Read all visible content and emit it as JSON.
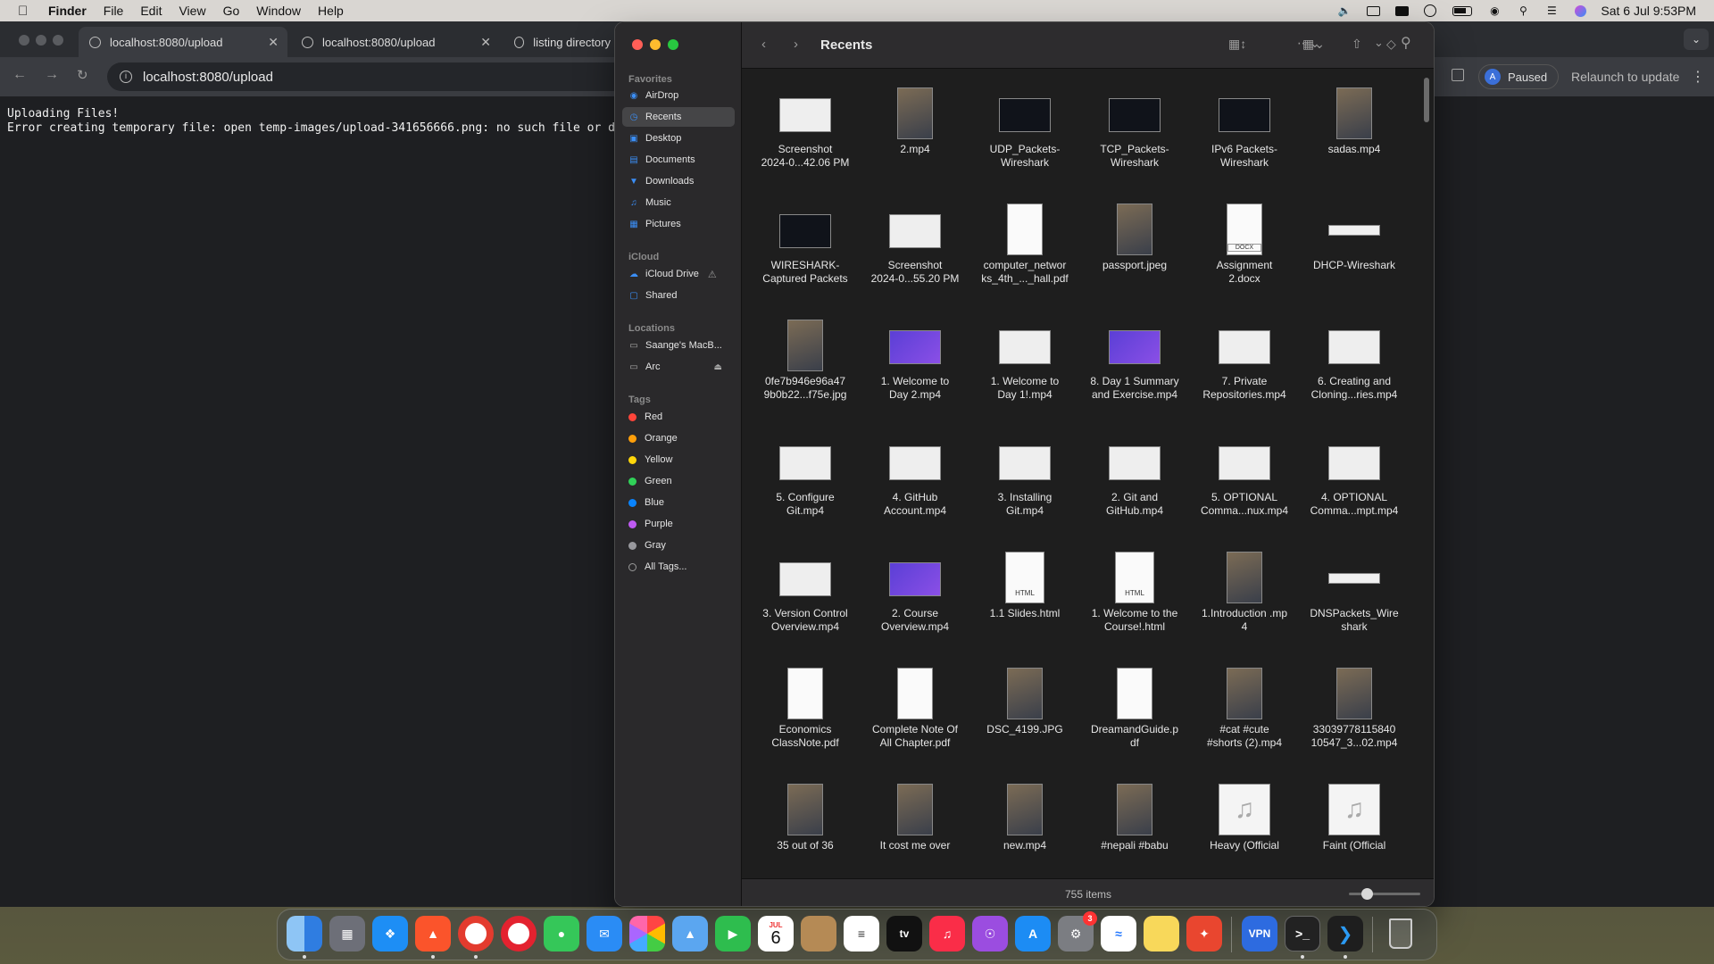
{
  "menubar": {
    "app": "Finder",
    "items": [
      "File",
      "Edit",
      "View",
      "Go",
      "Window",
      "Help"
    ],
    "clock": "Sat 6 Jul  9:53PM"
  },
  "browser": {
    "tabs": [
      {
        "title": "localhost:8080/upload"
      },
      {
        "title": "localhost:8080/upload"
      },
      {
        "title": "listing directory"
      }
    ],
    "url": "localhost:8080/upload",
    "profile_initial": "A",
    "profile_status": "Paused",
    "relaunch": "Relaunch to update",
    "content_line1": "Uploading Files!",
    "content_line2": "Error creating temporary file: open temp-images/upload-341656666.png: no such file or d"
  },
  "finder": {
    "title": "Recents",
    "sidebar": {
      "favorites_head": "Favorites",
      "favorites": [
        "AirDrop",
        "Recents",
        "Desktop",
        "Documents",
        "Downloads",
        "Music",
        "Pictures"
      ],
      "icloud_head": "iCloud",
      "icloud": [
        "iCloud Drive",
        "Shared"
      ],
      "locations_head": "Locations",
      "locations": [
        "Saange's MacB...",
        "Arc"
      ],
      "tags_head": "Tags",
      "tags": [
        {
          "name": "Red",
          "color": "#ff453a"
        },
        {
          "name": "Orange",
          "color": "#ff9f0a"
        },
        {
          "name": "Yellow",
          "color": "#ffd60a"
        },
        {
          "name": "Green",
          "color": "#30d158"
        },
        {
          "name": "Blue",
          "color": "#0a84ff"
        },
        {
          "name": "Purple",
          "color": "#bf5af2"
        },
        {
          "name": "Gray",
          "color": "#98989d"
        },
        {
          "name": "All Tags...",
          "color": ""
        }
      ]
    },
    "files": [
      [
        "Screenshot\n2024-0...42.06 PM",
        "2.mp4",
        "UDP_Packets-\nWireshark",
        "TCP_Packets-\nWireshark",
        "IPv6 Packets-\nWireshark",
        "sadas.mp4"
      ],
      [
        "WIRESHARK-\nCaptured Packets",
        "Screenshot\n2024-0...55.20 PM",
        "computer_networ\nks_4th_..._hall.pdf",
        "passport.jpeg",
        "Assignment\n2.docx",
        "DHCP-Wireshark"
      ],
      [
        "0fe7b946e96a47\n9b0b22...f75e.jpg",
        "1. Welcome to\nDay 2.mp4",
        "1. Welcome to\nDay 1!.mp4",
        "8. Day 1 Summary\nand Exercise.mp4",
        "7. Private\nRepositories.mp4",
        "6. Creating and\nCloning...ries.mp4"
      ],
      [
        "5. Configure\nGit.mp4",
        "4. GitHub\nAccount.mp4",
        "3. Installing\nGit.mp4",
        "2. Git and\nGitHub.mp4",
        "5. OPTIONAL\nComma...nux.mp4",
        "4. OPTIONAL\nComma...mpt.mp4"
      ],
      [
        "3. Version Control\nOverview.mp4",
        "2. Course\nOverview.mp4",
        "1.1 Slides.html",
        "1. Welcome to the\nCourse!.html",
        "1.Introduction .mp\n4",
        "DNSPackets_Wire\nshark"
      ],
      [
        "Economics\nClassNote.pdf",
        "Complete Note Of\nAll Chapter.pdf",
        "DSC_4199.JPG",
        "DreamandGuide.p\ndf",
        "#cat #cute\n#shorts (2).mp4",
        "33039778115840\n10547_3...02.mp4"
      ],
      [
        "35 out of 36",
        "It cost me over",
        "new.mp4",
        "#nepali #babu",
        "Heavy (Official",
        "Faint (Official"
      ]
    ],
    "item_count": "755 items"
  },
  "icons": {
    "finder": "finder-icon",
    "trash": "trash-icon"
  },
  "dock": {
    "calendar_month": "JUL",
    "calendar_day": "6",
    "settings_badge": "3",
    "vpn": "VPN"
  }
}
